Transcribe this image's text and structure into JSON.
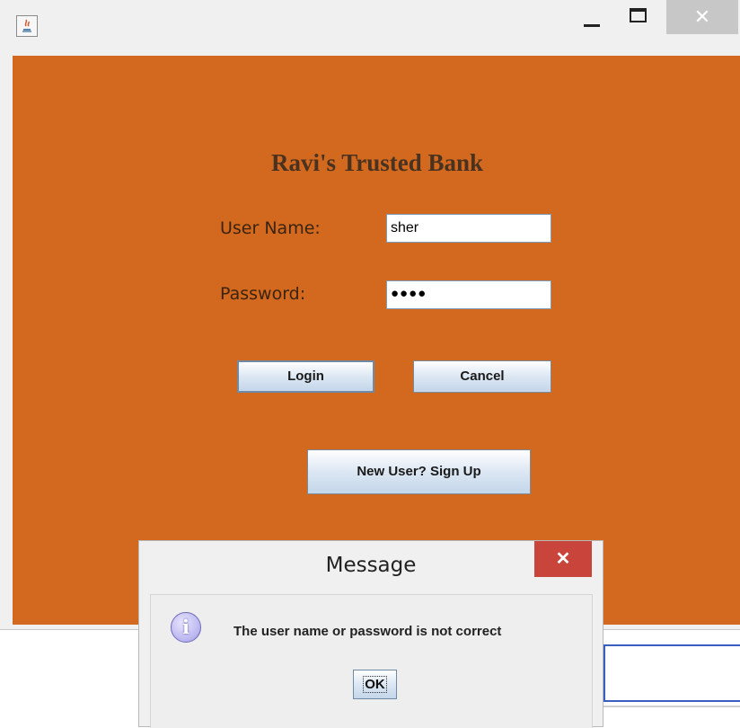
{
  "window": {
    "close_glyph": "✕"
  },
  "form": {
    "title": "Ravi's Trusted Bank",
    "username_label": "User Name:",
    "username_value": "sher",
    "password_label": "Password:",
    "password_value": "●●●●",
    "login_label": "Login",
    "cancel_label": "Cancel",
    "signup_label": "New User? Sign Up"
  },
  "dialog": {
    "title": "Message",
    "close_glyph": "✕",
    "icon_glyph": "i",
    "message": "The user name or password is not correct",
    "ok_label": "OK"
  },
  "colors": {
    "panel_background": "#d2691e",
    "dialog_close": "#c9453c"
  },
  "icons": [
    "java-app-icon",
    "minimize-icon",
    "maximize-icon",
    "close-icon",
    "info-icon"
  ]
}
